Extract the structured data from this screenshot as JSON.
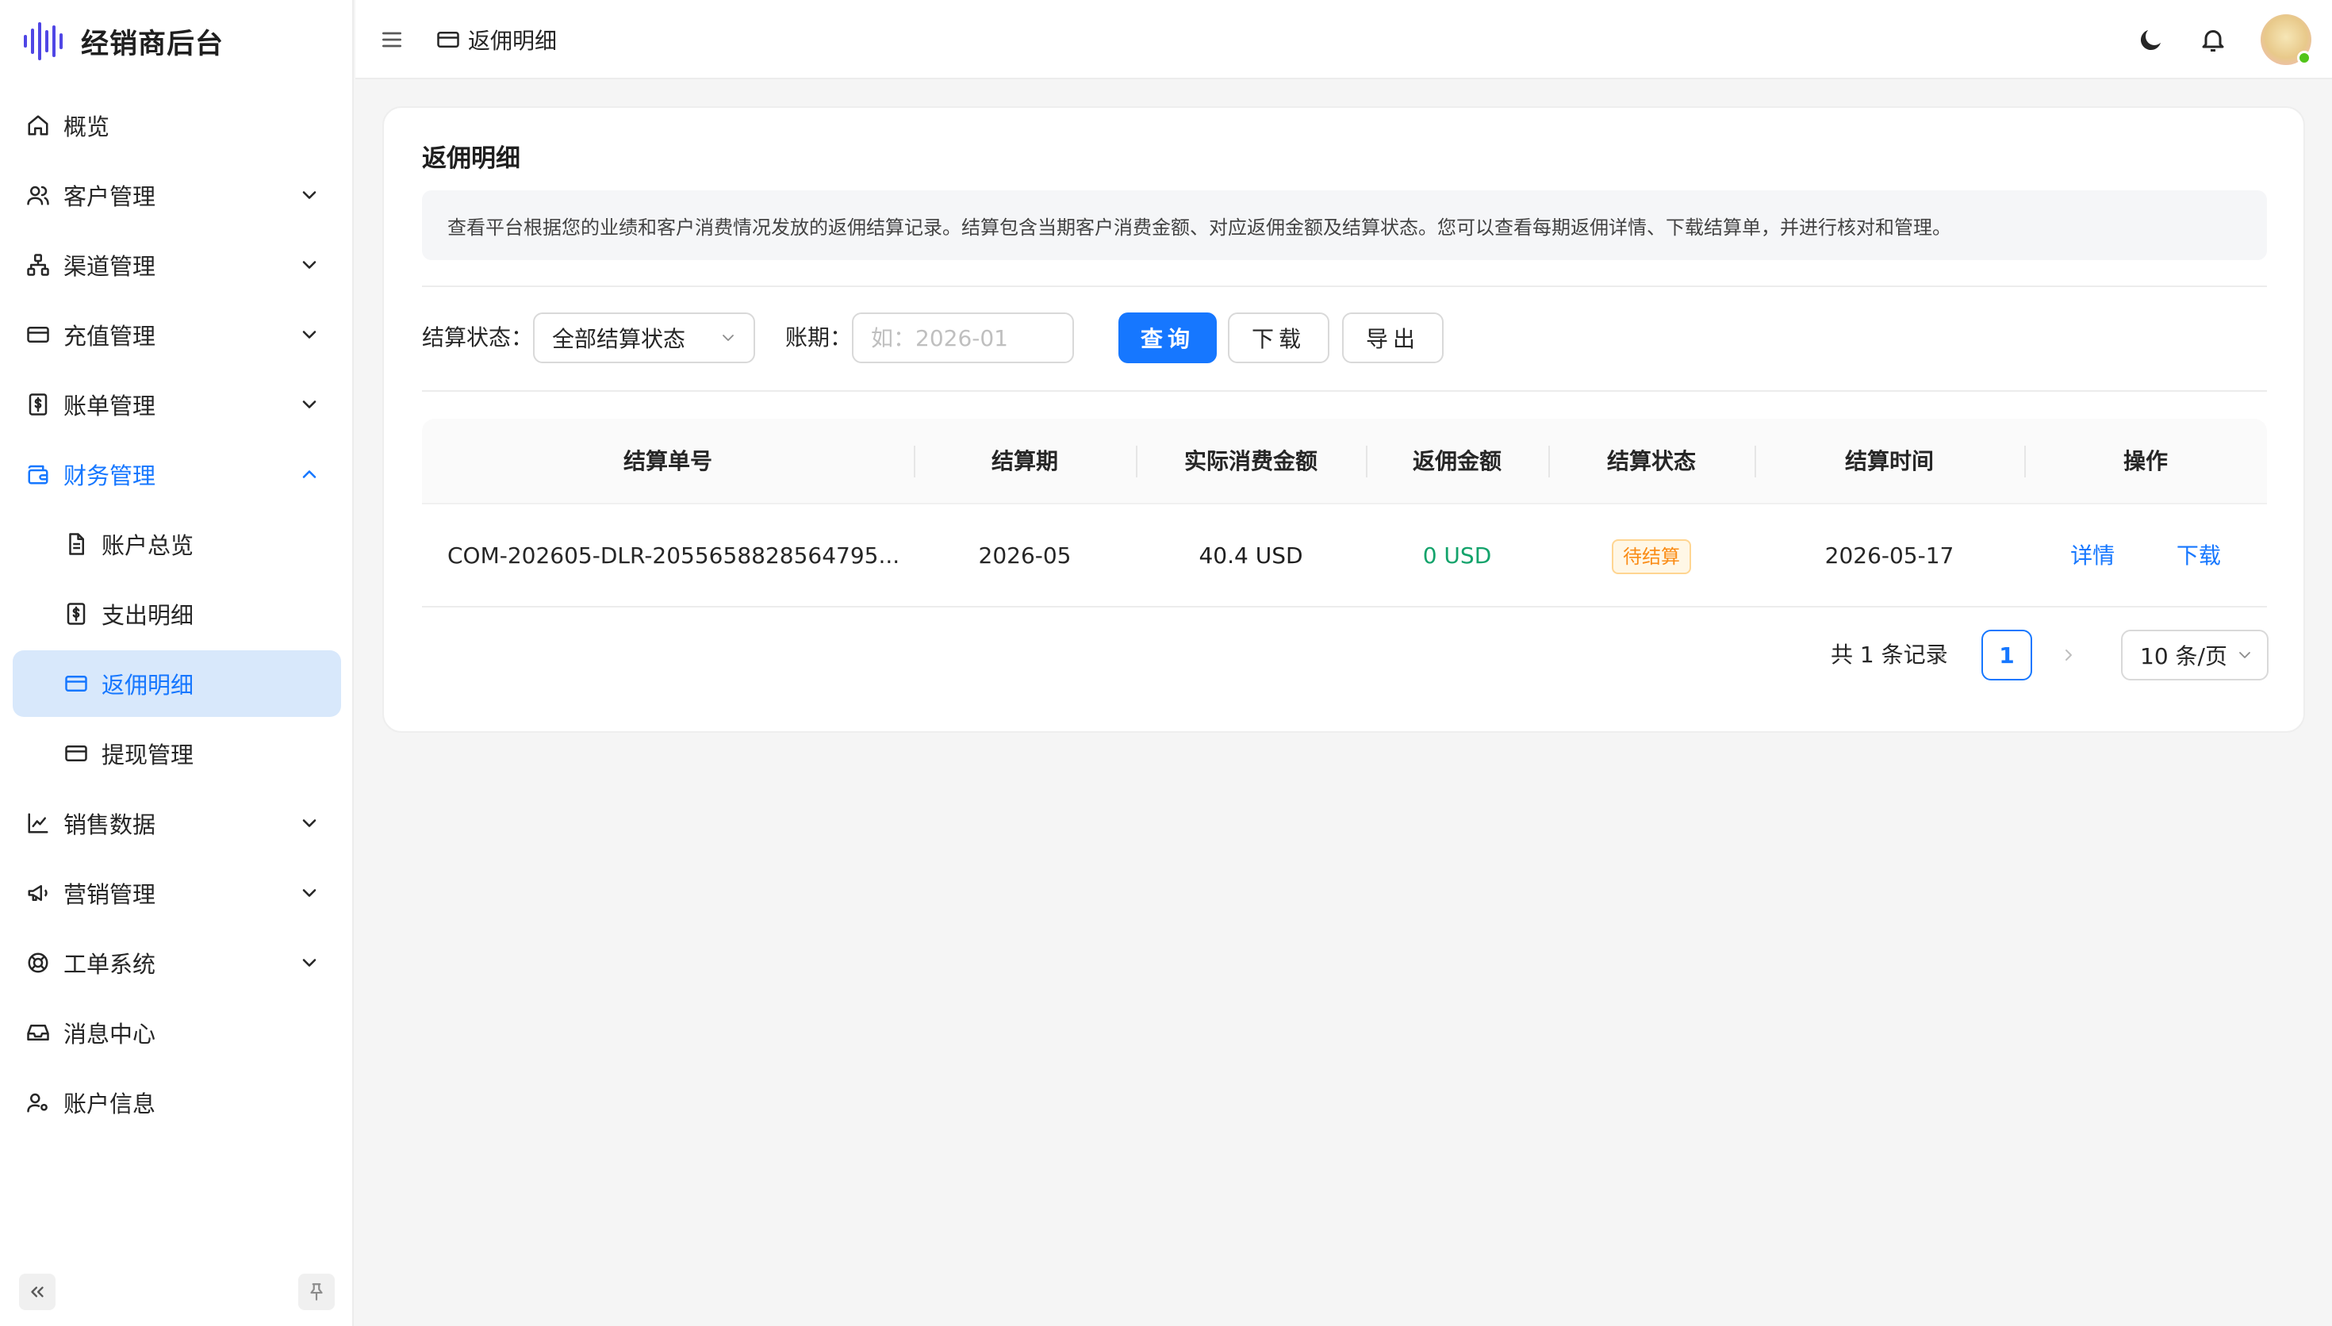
{
  "brand": {
    "title": "经销商后台",
    "accent": "#4f46e5"
  },
  "colors": {
    "primary": "#1677ff",
    "active_bg": "#d8e8fb",
    "success": "#13a36b",
    "warning": "#fa8c16"
  },
  "sidebar": {
    "items": [
      {
        "label": "概览",
        "icon": "home-icon"
      },
      {
        "label": "客户管理",
        "icon": "users-icon"
      },
      {
        "label": "渠道管理",
        "icon": "network-icon"
      },
      {
        "label": "充值管理",
        "icon": "credit-card-icon"
      },
      {
        "label": "账单管理",
        "icon": "bill-icon"
      },
      {
        "label": "财务管理",
        "icon": "wallet-icon"
      },
      {
        "label": "账户总览",
        "icon": "file-text-icon"
      },
      {
        "label": "支出明细",
        "icon": "bill-icon"
      },
      {
        "label": "返佣明细",
        "icon": "credit-card-icon"
      },
      {
        "label": "提现管理",
        "icon": "credit-card-icon"
      },
      {
        "label": "销售数据",
        "icon": "line-chart-icon"
      },
      {
        "label": "营销管理",
        "icon": "megaphone-icon"
      },
      {
        "label": "工单系统",
        "icon": "lifebuoy-icon"
      },
      {
        "label": "消息中心",
        "icon": "inbox-icon"
      },
      {
        "label": "账户信息",
        "icon": "user-settings-icon"
      }
    ]
  },
  "header": {
    "breadcrumb": "返佣明细"
  },
  "page": {
    "title": "返佣明细",
    "description": "查看平台根据您的业绩和客户消费情况发放的返佣结算记录。结算包含当期客户消费金额、对应返佣金额及结算状态。您可以查看每期返佣详情、下载结算单，并进行核对和管理。"
  },
  "filters": {
    "status_label": "结算状态：",
    "status_value": "全部结算状态",
    "period_label": "账期：",
    "period_placeholder": "如：2026-01",
    "query_button": "查询",
    "download_button": "下载",
    "export_button": "导出"
  },
  "table": {
    "columns": [
      "结算单号",
      "结算期",
      "实际消费金额",
      "返佣金额",
      "结算状态",
      "结算时间",
      "操作"
    ],
    "rows": [
      {
        "order_no": "COM-202605-DLR-2055658828564795...",
        "period": "2026-05",
        "spend": "40.4 USD",
        "rebate": "0 USD",
        "status": "待结算",
        "time": "2026-05-17",
        "action_detail": "详情",
        "action_download": "下载"
      }
    ]
  },
  "pagination": {
    "total": "共 1 条记录",
    "current": "1",
    "page_size": "10 条/页"
  }
}
